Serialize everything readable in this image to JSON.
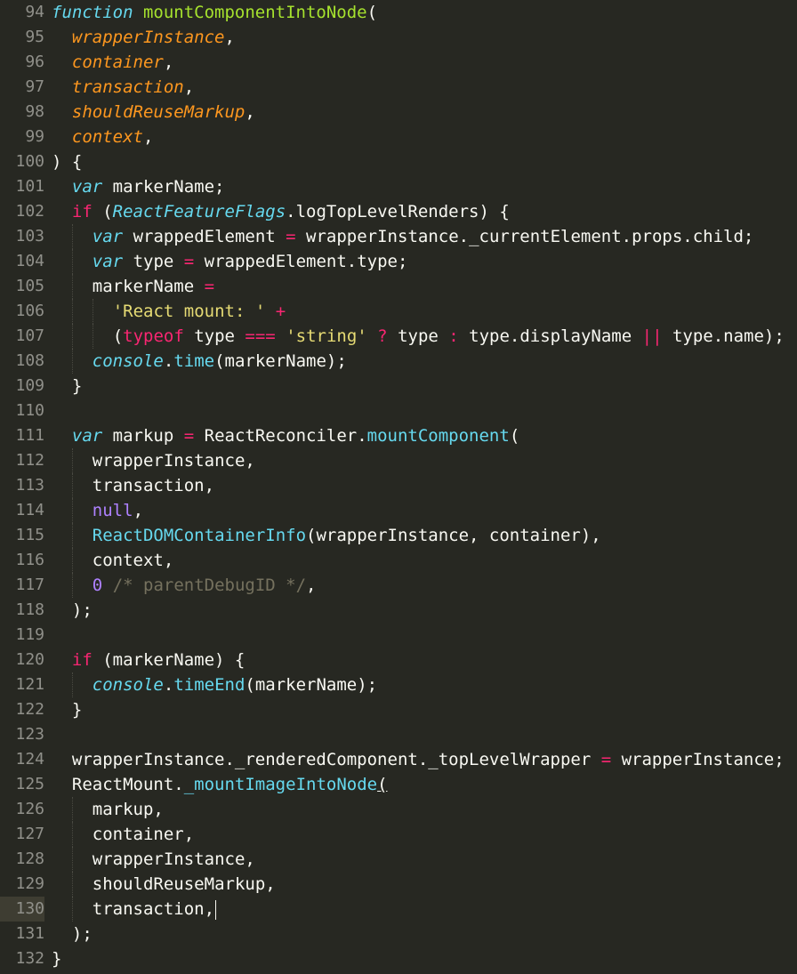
{
  "editor": {
    "theme": {
      "background": "#272822",
      "gutter_text": "#90908a",
      "current_line_gutter": "#3e3d32",
      "plain": "#f8f8f2",
      "keyword": "#f92672",
      "storage": "#66d9ef",
      "function_name": "#a6e22e",
      "parameter": "#fd971f",
      "string": "#e6db74",
      "number_constant": "#ae81ff",
      "support": "#66d9ef",
      "comment": "#75715e"
    },
    "current_line": 130,
    "lines": [
      {
        "num": "94",
        "indent": 0,
        "tokens": [
          [
            "storage-italic",
            "function"
          ],
          [
            "plain",
            " "
          ],
          [
            "function_name",
            "mountComponentIntoNode"
          ],
          [
            "plain",
            "("
          ]
        ]
      },
      {
        "num": "95",
        "indent": 1,
        "tokens": [
          [
            "parameter",
            "wrapperInstance"
          ],
          [
            "plain",
            ","
          ]
        ]
      },
      {
        "num": "96",
        "indent": 1,
        "tokens": [
          [
            "parameter",
            "container"
          ],
          [
            "plain",
            ","
          ]
        ]
      },
      {
        "num": "97",
        "indent": 1,
        "tokens": [
          [
            "parameter",
            "transaction"
          ],
          [
            "plain",
            ","
          ]
        ]
      },
      {
        "num": "98",
        "indent": 1,
        "tokens": [
          [
            "parameter",
            "shouldReuseMarkup"
          ],
          [
            "plain",
            ","
          ]
        ]
      },
      {
        "num": "99",
        "indent": 1,
        "tokens": [
          [
            "parameter",
            "context"
          ],
          [
            "plain",
            ","
          ]
        ]
      },
      {
        "num": "100",
        "indent": 0,
        "tokens": [
          [
            "plain",
            ") {"
          ]
        ]
      },
      {
        "num": "101",
        "indent": 1,
        "tokens": [
          [
            "storage-italic",
            "var"
          ],
          [
            "plain",
            " markerName;"
          ]
        ]
      },
      {
        "num": "102",
        "indent": 1,
        "tokens": [
          [
            "keyword",
            "if"
          ],
          [
            "plain",
            " ("
          ],
          [
            "support-italic",
            "ReactFeatureFlags"
          ],
          [
            "plain",
            ".logTopLevelRenders) {"
          ]
        ]
      },
      {
        "num": "103",
        "indent": 2,
        "tokens": [
          [
            "storage-italic",
            "var"
          ],
          [
            "plain",
            " wrappedElement "
          ],
          [
            "keyword",
            "="
          ],
          [
            "plain",
            " wrapperInstance._currentElement.props.child;"
          ]
        ]
      },
      {
        "num": "104",
        "indent": 2,
        "tokens": [
          [
            "storage-italic",
            "var"
          ],
          [
            "plain",
            " type "
          ],
          [
            "keyword",
            "="
          ],
          [
            "plain",
            " wrappedElement.type;"
          ]
        ]
      },
      {
        "num": "105",
        "indent": 2,
        "tokens": [
          [
            "plain",
            "markerName "
          ],
          [
            "keyword",
            "="
          ]
        ]
      },
      {
        "num": "106",
        "indent": 3,
        "tokens": [
          [
            "string",
            "'React mount: '"
          ],
          [
            "plain",
            " "
          ],
          [
            "keyword",
            "+"
          ]
        ]
      },
      {
        "num": "107",
        "indent": 3,
        "tokens": [
          [
            "plain",
            "("
          ],
          [
            "keyword",
            "typeof"
          ],
          [
            "plain",
            " type "
          ],
          [
            "keyword",
            "==="
          ],
          [
            "plain",
            " "
          ],
          [
            "string",
            "'string'"
          ],
          [
            "plain",
            " "
          ],
          [
            "keyword",
            "?"
          ],
          [
            "plain",
            " type "
          ],
          [
            "keyword",
            ":"
          ],
          [
            "plain",
            " type.displayName "
          ],
          [
            "keyword",
            "||"
          ],
          [
            "plain",
            " type.name);"
          ]
        ]
      },
      {
        "num": "108",
        "indent": 2,
        "tokens": [
          [
            "support-italic",
            "console"
          ],
          [
            "plain",
            "."
          ],
          [
            "support",
            "time"
          ],
          [
            "plain",
            "(markerName);"
          ]
        ]
      },
      {
        "num": "109",
        "indent": 1,
        "tokens": [
          [
            "plain",
            "}"
          ]
        ]
      },
      {
        "num": "110",
        "indent": 0,
        "tokens": []
      },
      {
        "num": "111",
        "indent": 1,
        "tokens": [
          [
            "storage-italic",
            "var"
          ],
          [
            "plain",
            " markup "
          ],
          [
            "keyword",
            "="
          ],
          [
            "plain",
            " ReactReconciler."
          ],
          [
            "support",
            "mountComponent"
          ],
          [
            "plain",
            "("
          ]
        ]
      },
      {
        "num": "112",
        "indent": 2,
        "tokens": [
          [
            "plain",
            "wrapperInstance,"
          ]
        ]
      },
      {
        "num": "113",
        "indent": 2,
        "tokens": [
          [
            "plain",
            "transaction,"
          ]
        ]
      },
      {
        "num": "114",
        "indent": 2,
        "tokens": [
          [
            "number_constant",
            "null"
          ],
          [
            "plain",
            ","
          ]
        ]
      },
      {
        "num": "115",
        "indent": 2,
        "tokens": [
          [
            "support",
            "ReactDOMContainerInfo"
          ],
          [
            "plain",
            "(wrapperInstance, container),"
          ]
        ]
      },
      {
        "num": "116",
        "indent": 2,
        "tokens": [
          [
            "plain",
            "context,"
          ]
        ]
      },
      {
        "num": "117",
        "indent": 2,
        "tokens": [
          [
            "number_constant",
            "0"
          ],
          [
            "plain",
            " "
          ],
          [
            "comment",
            "/* parentDebugID */"
          ],
          [
            "plain",
            ","
          ]
        ]
      },
      {
        "num": "118",
        "indent": 1,
        "tokens": [
          [
            "plain",
            ");"
          ]
        ]
      },
      {
        "num": "119",
        "indent": 0,
        "tokens": []
      },
      {
        "num": "120",
        "indent": 1,
        "tokens": [
          [
            "keyword",
            "if"
          ],
          [
            "plain",
            " (markerName) {"
          ]
        ]
      },
      {
        "num": "121",
        "indent": 2,
        "tokens": [
          [
            "support-italic",
            "console"
          ],
          [
            "plain",
            "."
          ],
          [
            "support",
            "timeEnd"
          ],
          [
            "plain",
            "(markerName);"
          ]
        ]
      },
      {
        "num": "122",
        "indent": 1,
        "tokens": [
          [
            "plain",
            "}"
          ]
        ]
      },
      {
        "num": "123",
        "indent": 0,
        "tokens": []
      },
      {
        "num": "124",
        "indent": 1,
        "tokens": [
          [
            "plain",
            "wrapperInstance._renderedComponent._topLevelWrapper "
          ],
          [
            "keyword",
            "="
          ],
          [
            "plain",
            " wrapperInstance;"
          ]
        ]
      },
      {
        "num": "125",
        "indent": 1,
        "tokens": [
          [
            "plain",
            "ReactMount."
          ],
          [
            "support",
            "_mountImageIntoNode"
          ],
          [
            "bracket",
            "("
          ]
        ]
      },
      {
        "num": "126",
        "indent": 2,
        "tokens": [
          [
            "plain",
            "markup,"
          ]
        ]
      },
      {
        "num": "127",
        "indent": 2,
        "tokens": [
          [
            "plain",
            "container,"
          ]
        ]
      },
      {
        "num": "128",
        "indent": 2,
        "tokens": [
          [
            "plain",
            "wrapperInstance,"
          ]
        ]
      },
      {
        "num": "129",
        "indent": 2,
        "tokens": [
          [
            "plain",
            "shouldReuseMarkup,"
          ]
        ]
      },
      {
        "num": "130",
        "indent": 2,
        "tokens": [
          [
            "plain",
            "transaction,"
          ],
          [
            "cursor",
            ""
          ]
        ]
      },
      {
        "num": "131",
        "indent": 1,
        "tokens": [
          [
            "plain",
            ");"
          ]
        ]
      },
      {
        "num": "132",
        "indent": 0,
        "tokens": [
          [
            "plain",
            "}"
          ]
        ]
      }
    ]
  }
}
